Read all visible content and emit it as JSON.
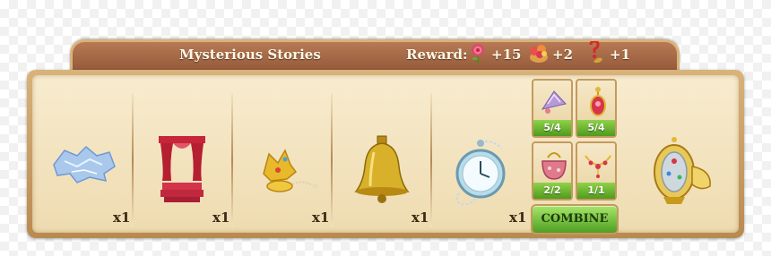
{
  "window": {
    "title": "Mysterious Stories"
  },
  "reward": {
    "label": "Reward:",
    "items": [
      {
        "icon": "rose-icon",
        "amount": "+15"
      },
      {
        "icon": "flower-bouquet-icon",
        "amount": "+2"
      },
      {
        "icon": "mystery-item-icon",
        "amount": "+1"
      }
    ]
  },
  "slots": [
    {
      "icon": "ice-crystal-icon",
      "count": "x1"
    },
    {
      "icon": "red-curtain-icon",
      "count": "x1"
    },
    {
      "icon": "gold-jewelry-icon",
      "count": "x1"
    },
    {
      "icon": "golden-bell-icon",
      "count": "x1"
    },
    {
      "icon": "pocket-watch-icon",
      "count": "x1"
    }
  ],
  "sub_items": [
    {
      "icon": "fan-icon",
      "count": "5/4"
    },
    {
      "icon": "earring-icon",
      "count": "5/4"
    },
    {
      "icon": "purse-icon",
      "count": "2/2"
    },
    {
      "icon": "necklace-icon",
      "count": "1/1"
    }
  ],
  "combine": {
    "label": "COMBINE"
  },
  "result": {
    "icon": "jeweled-egg-icon"
  },
  "colors": {
    "title_bar": "#8f5636",
    "panel": "#f8eccf",
    "counter_green": "#4f9a1e"
  }
}
